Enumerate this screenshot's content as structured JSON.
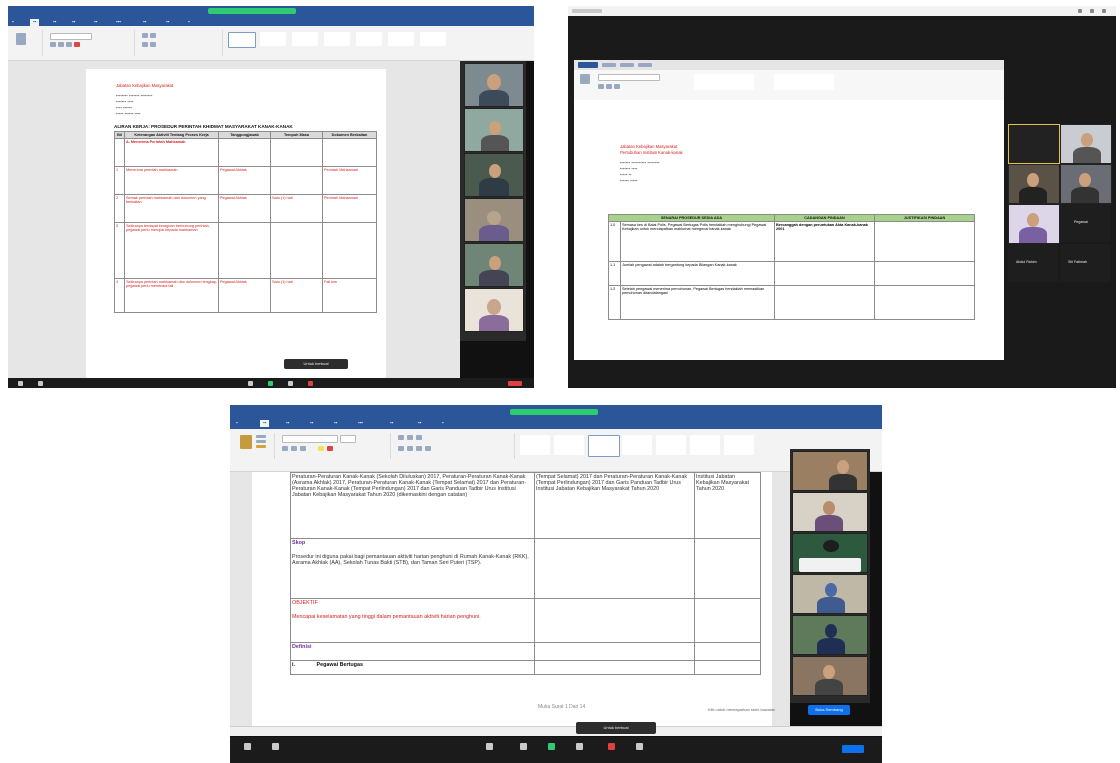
{
  "colors": {
    "word_blue": "#2b579a",
    "zoom_green": "#2ecc71",
    "doc_red": "#d21e1e",
    "table_header_green": "#a9d18e",
    "zoom_blue": "#0e71eb"
  },
  "screenshot1": {
    "document_heading": "Jabatan Kebajikan Masyarakat",
    "table_title": "ALIRAN KERJA: PROSEDUR PERINTAH KHIDMAT MASYARAKAT KANAK-KANAK",
    "table_headers": [
      "Bil",
      "Keterangan Aktiviti Tentang Proses Kerja",
      "Tanggungjawab",
      "Tempoh Masa",
      "Dokumen Berkaitan"
    ],
    "rows": [
      {
        "no": "",
        "activity": "A. Menerima Perintah Mahkamah",
        "owner": "",
        "time": "",
        "doc": ""
      },
      {
        "no": "1",
        "activity": "Menerima perintah mahkamah",
        "owner": "Pegawai Akhlak",
        "time": "",
        "doc": "Perintah Mahkamah"
      },
      {
        "no": "2",
        "activity": "Semak perintah mahkamah dan dokumen yang berkaitan",
        "owner": "Pegawai Akhlak",
        "time": "Satu (1) hari",
        "doc": "Perintah Mahkamah"
      },
      {
        "no": "3",
        "activity": "Sekiranya terdapat keraguan berhubung perintah, pegawai perlu merujuk kepada mahkamah",
        "owner": "",
        "time": "",
        "doc": ""
      },
      {
        "no": "4",
        "activity": "Sekiranya perintah mahkamah dan dokumen lengkap, pegawai perlu membuka fail",
        "owner": "Pegawai Akhlak",
        "time": "Satu (1) hari",
        "doc": "Fail kes"
      }
    ],
    "toast": "Untuk berbual"
  },
  "screenshot2": {
    "document_heading": "Jabatan Kebajikan Masyarakat",
    "document_subheading": "Pertubuhan Institusi Kanak-kanak",
    "table_headers": [
      "SENARAI PROSEDUR SEDIA ADA",
      "CADANGAN PINDAAN",
      "JUSTIFIKASI PINDAAN"
    ],
    "rows": [
      {
        "no": "1.0",
        "text": "Semasa kes di Balai Polis, Pegawai Bertugas Polis hendaklah menghubungi Pegawai Kebajikan untuk mendapatkan maklumat mengenai kanak-kanak",
        "proposal": "Bercanggah dengan peruntukan Akta Kanak-kanak 2001",
        "justification": ""
      },
      {
        "no": "1.1",
        "text": "Jumlah pengawal adalah bergantung kepada Bilangan Kanak-kanak",
        "proposal": "",
        "justification": ""
      },
      {
        "no": "1.2",
        "text": "Setelah pengawal menerima pemohonan, Pegawai Bertugas hendaklah memastikan pemohonan ditandatangani",
        "proposal": "",
        "justification": ""
      }
    ],
    "participants": [
      "Pegawai",
      "Abdul Rahim",
      "Siti Fatimah"
    ]
  },
  "screenshot3": {
    "col1_paragraph": "Peraturan-Peraturan Kanak-Kanak (Sekolah Diluluskan) 2017, Peraturan-Peraturan Kanak-Kanak (Asrama Akhlak) 2017, Peraturan-Peraturan Kanak-Kanak (Tempat Selamat) 2017 dan Peraturan-Peraturan Kanak-Kanak (Tempat Perlindungan) 2017 dan Garis Panduan Tadbir Urus Institusi Jabatan Kebajikan Masyarakat Tahun 2020 (dikemaskini dengan catatan)",
    "col2_paragraph": "(Tempat Selamat) 2017 dan Peraturan-Peraturan Kanak-Kanak (Tempat Perlindungan) 2017 dan Garis Panduan Tadbir Urus Institusi Jabatan Kebajikan Masyarakat Tahun 2020",
    "col3_paragraph": "Institusi Jabatan Kebajikan Masyarakat Tahun 2020",
    "scope_heading": "Skop",
    "scope_text": "Prosedur ini diguna pakai bagi pemantauan aktiviti harian penghuni di Rumah Kanak-Kanak (RKK), Asrama Akhlak (AA), Sekolah Tunas Bakti (STB), dan Taman Seri Puteri (TSP).",
    "objective_heading": "OBJEKTIF",
    "objective_text": "Mencapai keselamatan yang tinggi dalam pemantauan aktiviti harian penghuni.",
    "definition_heading": "Definisi",
    "definition_item": "Pegawai Bertugas",
    "definition_no": "i.",
    "page_indicator": "Muka Surat 1 Dari 14",
    "toast": "Untuk berbual",
    "zoom_button": "Buka Sembang",
    "zoom_hint": "Klik untuk memaparkan skrin kawalan"
  }
}
